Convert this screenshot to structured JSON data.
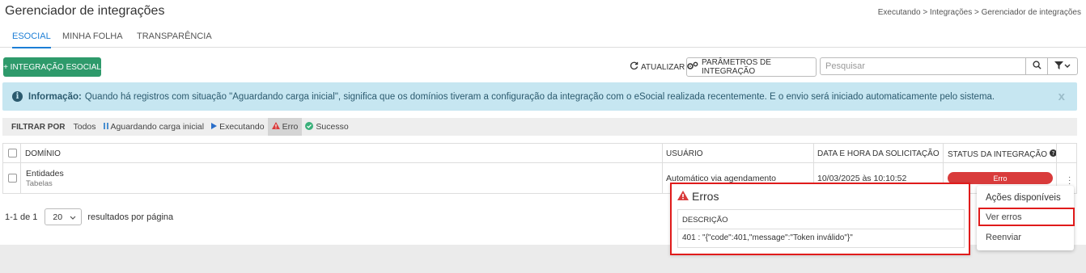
{
  "header": {
    "title": "Gerenciador de integrações",
    "breadcrumb": "Executando > Integrações > Gerenciador de integrações"
  },
  "tabs": [
    {
      "label": "ESOCIAL",
      "active": true
    },
    {
      "label": "MINHA FOLHA",
      "active": false
    },
    {
      "label": "TRANSPARÊNCIA",
      "active": false
    }
  ],
  "toolbar": {
    "add_button": "+ INTEGRAÇÃO ESOCIAL",
    "refresh_label": "ATUALIZAR",
    "params_button": "PARÂMETROS DE INTEGRAÇÃO",
    "search_placeholder": "Pesquisar"
  },
  "info": {
    "bold": "Informação:",
    "text": "Quando há registros com situação \"Aguardando carga inicial\", significa que os domínios tiveram a configuração da integração com o eSocial realizada recentemente. E o envio será iniciado automaticamente pelo sistema.",
    "close": "x"
  },
  "filter": {
    "label": "FILTRAR POR",
    "options": [
      "Todos",
      "Aguardando carga inicial",
      "Executando",
      "Erro",
      "Sucesso"
    ],
    "active": "Erro"
  },
  "table": {
    "headers": [
      "DOMÍNIO",
      "USUÁRIO",
      "DATA E HORA DA SOLICITAÇÃO",
      "STATUS DA INTEGRAÇÃO"
    ],
    "rows": [
      {
        "dominio": "Entidades",
        "dominio_sub": "Tabelas",
        "usuario": "Automático via agendamento",
        "data": "10/03/2025 às 10:10:52",
        "status": "Erro"
      }
    ]
  },
  "pagination": {
    "range": "1-1 de 1",
    "per_page": "20",
    "per_page_label": "resultados por página"
  },
  "erros_panel": {
    "title": "Erros",
    "column": "DESCRIÇÃO",
    "value": "401 : \"{\"code\":401,\"message\":\"Token inválido\"}\""
  },
  "actions_menu": {
    "title": "Ações disponíveis",
    "items": [
      "Ver erros",
      "Reenviar"
    ]
  },
  "colors": {
    "accent": "#1c7ed6",
    "green": "#2e9a6b",
    "error": "#d93b3b",
    "info_bg": "#c6e6f1",
    "highlight": "#e01b1b"
  }
}
